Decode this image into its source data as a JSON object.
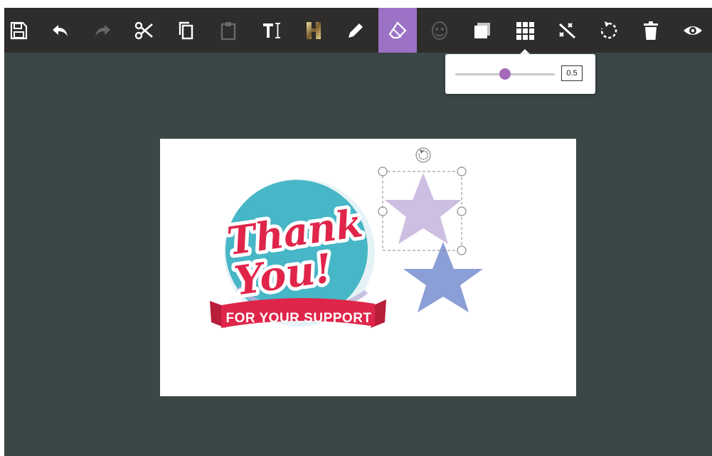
{
  "toolbar": {
    "active_tool": "eraser",
    "tools": [
      "save",
      "undo",
      "redo",
      "cut",
      "copy",
      "paste",
      "text",
      "highlight",
      "pencil",
      "eraser",
      "face-filter",
      "layers",
      "grid",
      "magic",
      "rotate",
      "delete",
      "preview"
    ]
  },
  "opacity_popup": {
    "value": "0.5",
    "slider_fraction": 0.5
  },
  "canvas": {
    "sticker": {
      "line1": "Thank",
      "line2": "You!",
      "banner": "FOR YOUR SUPPORT"
    }
  },
  "colors": {
    "toolbar_bg": "#2f2d2b",
    "active_tool_bg": "#9b72c6",
    "workspace_bg": "#3b4646",
    "star_selected": "#c8b8de",
    "star_blue": "#8c9ed6",
    "sticker_red": "#e0254a",
    "sticker_teal": "#47b6c7"
  }
}
